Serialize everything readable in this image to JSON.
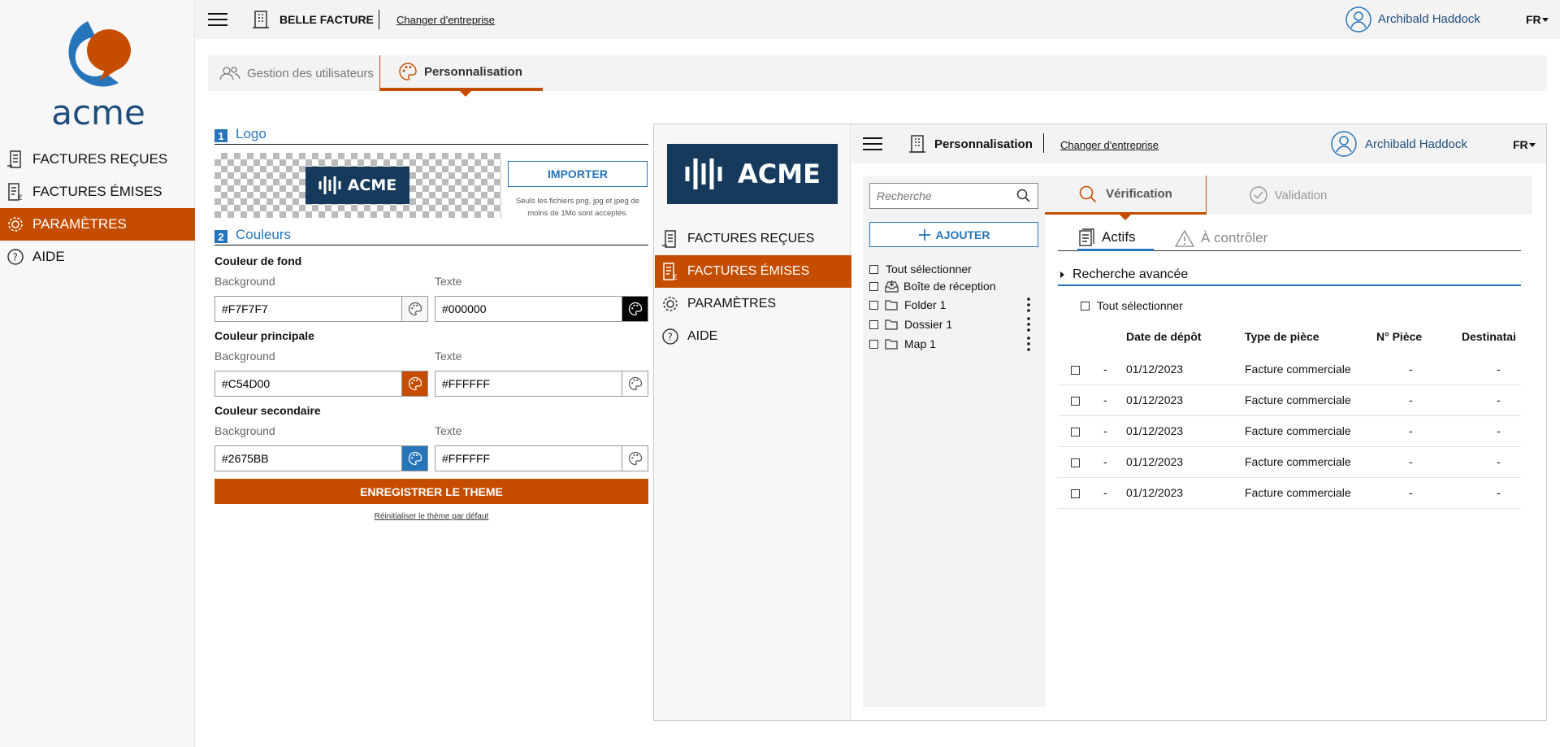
{
  "sidebar": {
    "brand": "acme",
    "items": [
      {
        "label": "FACTURES REÇUES",
        "icon": "invoice-received-icon"
      },
      {
        "label": "FACTURES ÉMISES",
        "icon": "invoice-sent-icon"
      },
      {
        "label": "PARAMÈTRES",
        "icon": "gear-icon",
        "active": true
      },
      {
        "label": "AIDE",
        "icon": "help-icon"
      }
    ]
  },
  "topbar": {
    "company": "BELLE FACTURE",
    "change_company": "Changer d'entreprise",
    "user": "Archibald Haddock",
    "lang": "FR"
  },
  "tabs": [
    {
      "label": "Gestion des utilisateurs",
      "icon": "users-icon"
    },
    {
      "label": "Personnalisation",
      "icon": "palette-icon",
      "active": true
    }
  ],
  "logo_section": {
    "number": "1",
    "title": "Logo",
    "preview_text": "ACME",
    "import_label": "IMPORTER",
    "hint_line1": "Seuls les fichiers png, jpg et jpeg de",
    "hint_line2": "moins de 1Mo sont acceptés."
  },
  "colors_section": {
    "number": "2",
    "title": "Couleurs",
    "groups": [
      {
        "title": "Couleur de fond",
        "bg_label": "Background",
        "text_label": "Texte",
        "bg_value": "#F7F7F7",
        "text_value": "#000000",
        "bg_swatch": "#F7F7F7",
        "text_swatch": "#000000"
      },
      {
        "title": "Couleur principale",
        "bg_label": "Background",
        "text_label": "Texte",
        "bg_value": "#C54D00",
        "text_value": "#FFFFFF",
        "bg_swatch": "#C54D00",
        "text_swatch": "#FFFFFF"
      },
      {
        "title": "Couleur secondaire",
        "bg_label": "Background",
        "text_label": "Texte",
        "bg_value": "#2675BB",
        "text_value": "#FFFFFF",
        "bg_swatch": "#2675BB",
        "text_swatch": "#FFFFFF"
      }
    ],
    "save_label": "ENREGISTRER LE THEME",
    "reset_label": "Réinitialiser le thème par défaut"
  },
  "preview": {
    "logo_text": "ACME",
    "nav": [
      {
        "label": "FACTURES REÇUES",
        "icon": "invoice-received-icon"
      },
      {
        "label": "FACTURES ÉMISES",
        "icon": "invoice-sent-icon",
        "active": true
      },
      {
        "label": "PARAMÈTRES",
        "icon": "gear-icon"
      },
      {
        "label": "AIDE",
        "icon": "help-icon"
      }
    ],
    "topbar": {
      "page": "Personnalisation",
      "change_company": "Changer d'entreprise",
      "user": "Archibald Haddock",
      "lang": "FR"
    },
    "search_placeholder": "Recherche",
    "add_label": "AJOUTER",
    "tree": [
      {
        "label": "Tout sélectionner",
        "icon": ""
      },
      {
        "label": "Boîte de réception",
        "icon": "inbox-icon"
      },
      {
        "label": "Folder 1",
        "icon": "folder-icon"
      },
      {
        "label": "Dossier 1",
        "icon": "folder-icon"
      },
      {
        "label": "Map 1",
        "icon": "folder-icon"
      }
    ],
    "steps": [
      {
        "label": "Vérification",
        "active": true
      },
      {
        "label": "Validation"
      }
    ],
    "subtabs": [
      {
        "label": "Actifs",
        "active": true
      },
      {
        "label": "À contrôler"
      }
    ],
    "advanced_search": "Recherche avancée",
    "select_all": "Tout sélectionner",
    "table": {
      "headers": [
        "Date de dépôt",
        "Type de pièce",
        "N° Pièce",
        "Destinatai"
      ],
      "rows": [
        {
          "dash": "-",
          "date": "01/12/2023",
          "type": "Facture commerciale",
          "num": "-",
          "dest": "-"
        },
        {
          "dash": "-",
          "date": "01/12/2023",
          "type": "Facture commerciale",
          "num": "-",
          "dest": "-"
        },
        {
          "dash": "-",
          "date": "01/12/2023",
          "type": "Facture commerciale",
          "num": "-",
          "dest": "-"
        },
        {
          "dash": "-",
          "date": "01/12/2023",
          "type": "Facture commerciale",
          "num": "-",
          "dest": "-"
        },
        {
          "dash": "-",
          "date": "01/12/2023",
          "type": "Facture commerciale",
          "num": "-",
          "dest": "-"
        }
      ]
    }
  },
  "colors": {
    "primary": "#C54D00",
    "secondary": "#2675BB",
    "navy": "#163a5c"
  }
}
